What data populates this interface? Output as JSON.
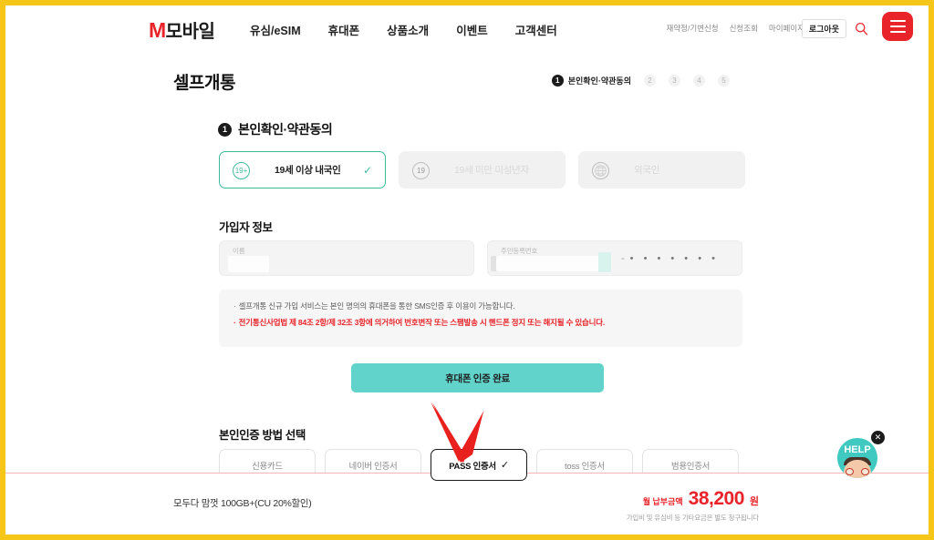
{
  "header": {
    "logo_mark": "M",
    "logo_word": "모바일",
    "nav": [
      {
        "label": "유심/eSIM"
      },
      {
        "label": "휴대폰"
      },
      {
        "label": "상품소개"
      },
      {
        "label": "이벤트"
      },
      {
        "label": "고객센터"
      }
    ],
    "util_links": [
      {
        "label": "재약정/기변신청"
      },
      {
        "label": "신청조회"
      },
      {
        "label": "마이페이지"
      }
    ],
    "logout_label": "로그아웃",
    "search_icon": "search-icon",
    "menu_icon": "hamburger-menu-icon",
    "brand_color": "#E8242A"
  },
  "page": {
    "title": "셀프개통",
    "steps": [
      {
        "num": "1",
        "label": "본인확인·약관동의",
        "active": true
      },
      {
        "num": "2",
        "label": "",
        "active": false
      },
      {
        "num": "3",
        "label": "",
        "active": false
      },
      {
        "num": "4",
        "label": "",
        "active": false
      },
      {
        "num": "5",
        "label": "",
        "active": false
      }
    ]
  },
  "section": {
    "bullet": "1",
    "title": "본인확인·약관동의"
  },
  "user_type_cards": [
    {
      "label": "19세 이상 내국인",
      "icon": "person-circle-icon",
      "state": "selected",
      "check": "✓"
    },
    {
      "label": "19세 미만 미성년자",
      "icon": "person-circle-icon",
      "state": "disabled",
      "check": ""
    },
    {
      "label": "외국인",
      "icon": "globe-icon",
      "state": "disabled",
      "check": ""
    }
  ],
  "subscriber": {
    "title": "가입자 정보",
    "name_label": "이름",
    "rrn_label": "주민등록번호",
    "rrn_separator": "-",
    "rrn_masked": "• • • • • • •"
  },
  "notice": {
    "line1": "셀프개통 신규 가입 서비스는 본인 명의의 휴대폰을 통한 SMS인증 후 이용이 가능합니다.",
    "line2": "전기통신사업법 제 84조 2항/제 32조 3항에 의거하여 번호변작 또는 스팸발송 시 핸드폰 정지 또는 해지될 수 있습니다.",
    "bullet": "·",
    "alert_color": "#E8242A"
  },
  "verify_button": {
    "label": "휴대폰 인증 완료",
    "color": "#62D3CB"
  },
  "auth": {
    "title": "본인인증 방법 선택",
    "methods": [
      {
        "label": "신용카드",
        "selected": false,
        "check": ""
      },
      {
        "label": "네이버 인증서",
        "selected": false,
        "check": ""
      },
      {
        "label": "PASS 인증서",
        "selected": true,
        "check": "✓"
      },
      {
        "label": "toss 인증서",
        "selected": false,
        "check": ""
      },
      {
        "label": "범용인증서",
        "selected": false,
        "check": ""
      }
    ],
    "annotation_icon": "red-arrow-pointer-icon",
    "annotation_color": "#E8201E"
  },
  "bottom_bar": {
    "collapse_icon": "double-chevron-up-icon",
    "plan_name": "모두다 맘껏 100GB+(CU 20%할인)",
    "price_label": "월 납부금액",
    "price_value": "38,200",
    "price_unit": "원",
    "price_note": "가입비 및 유심비 등 기타요금은 별도 청구됩니다",
    "price_color": "#E8242A"
  },
  "help_widget": {
    "label": "HELP",
    "close_icon": "close-icon",
    "close_glyph": "✕",
    "color": "#3FC9C0"
  }
}
